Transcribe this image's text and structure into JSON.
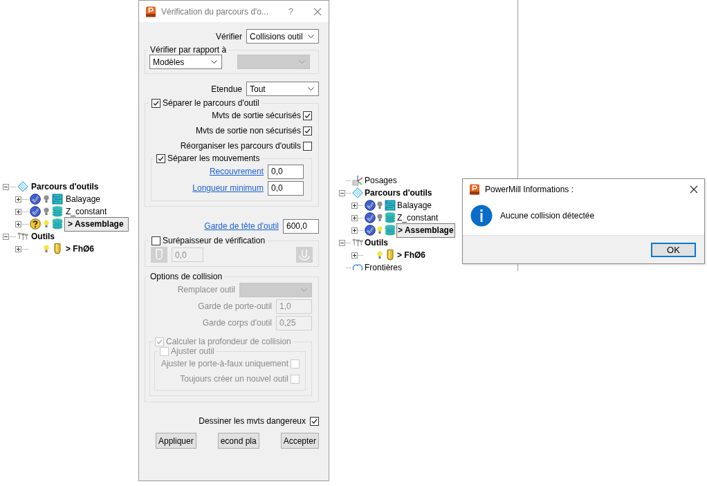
{
  "left_tree": {
    "items": [
      {
        "label": "Parcours d'outils",
        "kind": "toolpaths",
        "bold": true,
        "expanded": true,
        "selected": false,
        "children": [
          {
            "label": "Balayage",
            "kind": "raster",
            "verified": true,
            "light": false,
            "bold": false,
            "expanded": false,
            "selected": false
          },
          {
            "label": "Z_constant",
            "kind": "zlevel",
            "verified": true,
            "light": false,
            "bold": false,
            "expanded": false,
            "selected": false
          },
          {
            "label": "> Assemblage",
            "kind": "zlevel",
            "verified": false,
            "light": true,
            "bold": true,
            "expanded": false,
            "selected": true
          }
        ]
      },
      {
        "label": "Outils",
        "kind": "tools",
        "bold": true,
        "expanded": true,
        "selected": false,
        "children": [
          {
            "label": "> FhØ6",
            "kind": "tool",
            "light": true,
            "bold": true,
            "expanded": false,
            "selected": false
          }
        ]
      }
    ]
  },
  "dialog": {
    "title": "Vérification du parcours d'o...",
    "help": "?",
    "verify": {
      "label": "Vérifier",
      "value": "Collisions outil"
    },
    "against": {
      "legend": "Vérifier par rapport à",
      "value": "Modèles",
      "second_disabled": true
    },
    "extent": {
      "label": "Etendue",
      "value": "Tout"
    },
    "split": {
      "label": "Séparer le parcours d'outil",
      "checked": true,
      "options": [
        {
          "label": "Mvts de sortie sécurisés",
          "checked": true
        },
        {
          "label": "Mvts de sortie non sécurisés",
          "checked": true
        },
        {
          "label": "Réorganiser les parcours d'outils",
          "checked": false
        }
      ],
      "moves": {
        "label": "Séparer les mouvements",
        "checked": true,
        "fields": [
          {
            "label": "Recouvrement",
            "value": "0,0"
          },
          {
            "label": "Longueur minimum",
            "value": "0,0"
          }
        ]
      }
    },
    "head_clearance": {
      "label": "Garde de tête d'outil",
      "value": "600,0"
    },
    "thickness": {
      "label": "Surépaisseur de vérification",
      "checked": false,
      "value": "0,0"
    },
    "collision": {
      "legend": "Options de collision",
      "disabled": true,
      "replace_label": "Remplacer outil",
      "fields": [
        {
          "label": "Garde de porte-outil",
          "value": "1,0"
        },
        {
          "label": "Garde corps d'outil",
          "value": "0,25"
        }
      ],
      "depth": {
        "label": "Calculer la profondeur de collision",
        "checked": true
      },
      "adjust": {
        "label": "Ajuster outil",
        "checked": false,
        "options": [
          {
            "label": "Ajuster le porte-à-faux uniquement",
            "checked": false
          },
          {
            "label": "Toujours créer un nouvel outil",
            "checked": false
          }
        ]
      }
    },
    "draw_dangerous": {
      "label": "Dessiner les mvts dangereux",
      "checked": true
    },
    "buttons": [
      "Appliquer",
      "econd pla",
      "Accepter"
    ]
  },
  "right_tree": {
    "items": [
      {
        "label": "Posages",
        "kind": "workplanes",
        "bold": false,
        "selected": false
      },
      {
        "label": "Parcours d'outils",
        "kind": "toolpaths",
        "bold": true,
        "expanded": true,
        "selected": false,
        "children": [
          {
            "label": "Balayage",
            "kind": "raster",
            "verified": true,
            "light": false,
            "bold": false,
            "expanded": false,
            "selected": false
          },
          {
            "label": "Z_constant",
            "kind": "zlevel",
            "verified": true,
            "light": false,
            "bold": false,
            "expanded": false,
            "selected": false
          },
          {
            "label": "> Assemblage",
            "kind": "zlevel",
            "verified": true,
            "light": true,
            "bold": true,
            "expanded": false,
            "selected": true
          }
        ]
      },
      {
        "label": "Outils",
        "kind": "tools",
        "bold": true,
        "expanded": true,
        "selected": false,
        "children": [
          {
            "label": "> FhØ6",
            "kind": "tool",
            "light": true,
            "bold": true,
            "expanded": false,
            "selected": false
          }
        ]
      },
      {
        "label": "Frontières",
        "kind": "boundaries",
        "bold": false,
        "selected": false
      }
    ]
  },
  "message": {
    "title": "PowerMill Informations :",
    "text": "Aucune collision détectée",
    "button": "OK"
  }
}
